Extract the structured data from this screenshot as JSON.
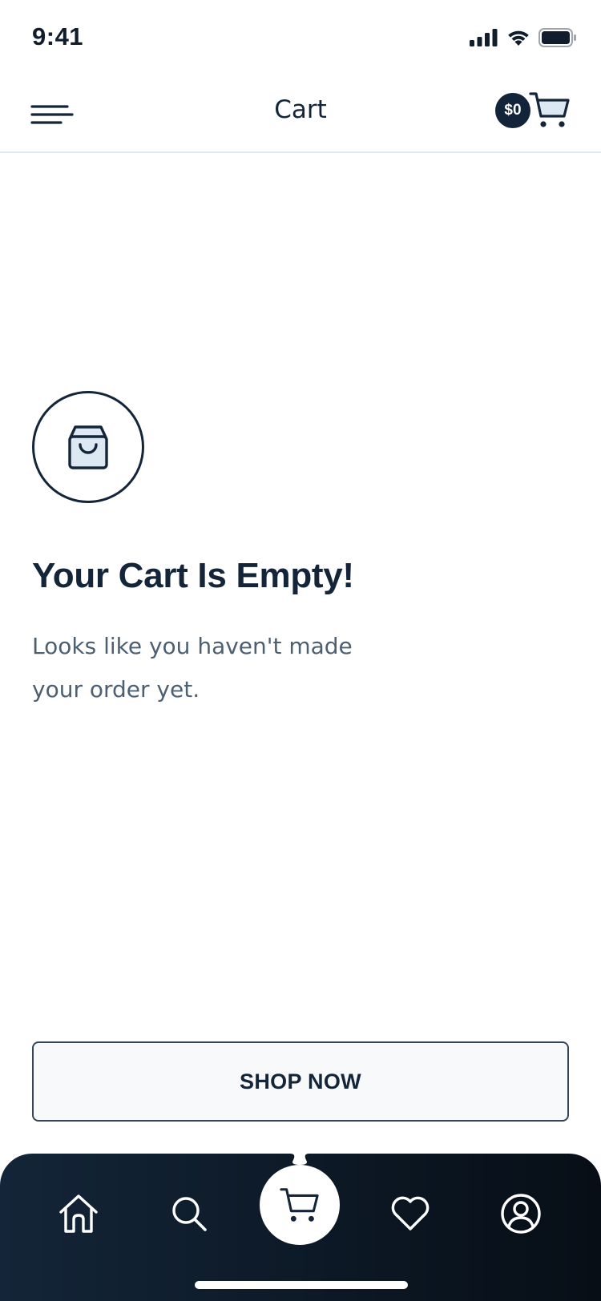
{
  "status_bar": {
    "time": "9:41",
    "icons": [
      "signal-icon",
      "wifi-icon",
      "battery-icon"
    ]
  },
  "header": {
    "title": "Cart",
    "cart_total": "$0",
    "icons": [
      "menu-icon",
      "cart-icon"
    ]
  },
  "empty_state": {
    "icon": "shopping-bag-icon",
    "title": "Your Cart Is Empty!",
    "subtitle_line1": "Looks like you haven't made",
    "subtitle_line2": "your order yet."
  },
  "shop_button": {
    "label": "SHOP NOW"
  },
  "bottom_nav": {
    "items": [
      {
        "icon": "home-icon"
      },
      {
        "icon": "search-icon"
      },
      {
        "icon": "cart-icon",
        "active": true
      },
      {
        "icon": "heart-icon"
      },
      {
        "icon": "profile-icon"
      }
    ]
  },
  "colors": {
    "primary": "#14253a",
    "muted_text": "#4d6072",
    "divider": "#e1eaf0",
    "nav_background": "#0f1f30",
    "button_background": "#f7f9fb"
  }
}
